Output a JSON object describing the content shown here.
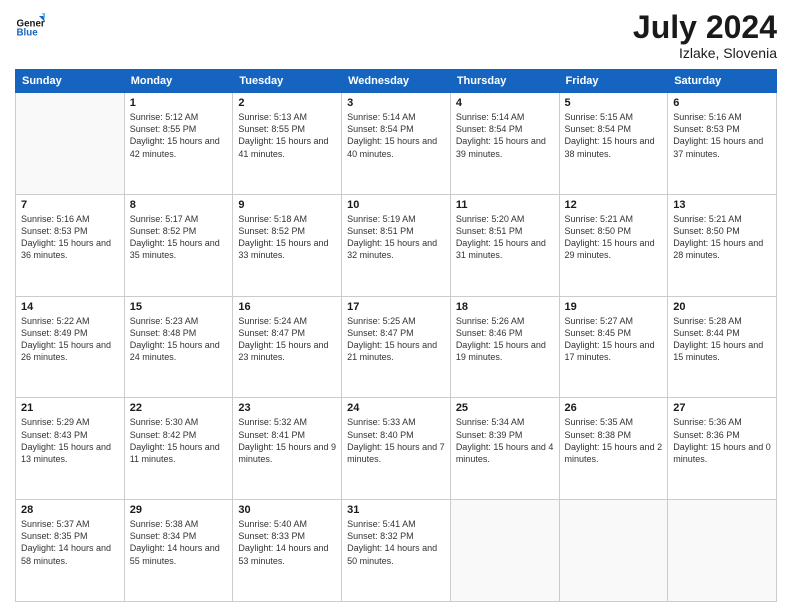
{
  "header": {
    "logo_general": "General",
    "logo_blue": "Blue",
    "month_year": "July 2024",
    "location": "Izlake, Slovenia"
  },
  "days_of_week": [
    "Sunday",
    "Monday",
    "Tuesday",
    "Wednesday",
    "Thursday",
    "Friday",
    "Saturday"
  ],
  "weeks": [
    [
      {
        "day": "",
        "info": ""
      },
      {
        "day": "1",
        "info": "Sunrise: 5:12 AM\nSunset: 8:55 PM\nDaylight: 15 hours\nand 42 minutes."
      },
      {
        "day": "2",
        "info": "Sunrise: 5:13 AM\nSunset: 8:55 PM\nDaylight: 15 hours\nand 41 minutes."
      },
      {
        "day": "3",
        "info": "Sunrise: 5:14 AM\nSunset: 8:54 PM\nDaylight: 15 hours\nand 40 minutes."
      },
      {
        "day": "4",
        "info": "Sunrise: 5:14 AM\nSunset: 8:54 PM\nDaylight: 15 hours\nand 39 minutes."
      },
      {
        "day": "5",
        "info": "Sunrise: 5:15 AM\nSunset: 8:54 PM\nDaylight: 15 hours\nand 38 minutes."
      },
      {
        "day": "6",
        "info": "Sunrise: 5:16 AM\nSunset: 8:53 PM\nDaylight: 15 hours\nand 37 minutes."
      }
    ],
    [
      {
        "day": "7",
        "info": "Sunrise: 5:16 AM\nSunset: 8:53 PM\nDaylight: 15 hours\nand 36 minutes."
      },
      {
        "day": "8",
        "info": "Sunrise: 5:17 AM\nSunset: 8:52 PM\nDaylight: 15 hours\nand 35 minutes."
      },
      {
        "day": "9",
        "info": "Sunrise: 5:18 AM\nSunset: 8:52 PM\nDaylight: 15 hours\nand 33 minutes."
      },
      {
        "day": "10",
        "info": "Sunrise: 5:19 AM\nSunset: 8:51 PM\nDaylight: 15 hours\nand 32 minutes."
      },
      {
        "day": "11",
        "info": "Sunrise: 5:20 AM\nSunset: 8:51 PM\nDaylight: 15 hours\nand 31 minutes."
      },
      {
        "day": "12",
        "info": "Sunrise: 5:21 AM\nSunset: 8:50 PM\nDaylight: 15 hours\nand 29 minutes."
      },
      {
        "day": "13",
        "info": "Sunrise: 5:21 AM\nSunset: 8:50 PM\nDaylight: 15 hours\nand 28 minutes."
      }
    ],
    [
      {
        "day": "14",
        "info": "Sunrise: 5:22 AM\nSunset: 8:49 PM\nDaylight: 15 hours\nand 26 minutes."
      },
      {
        "day": "15",
        "info": "Sunrise: 5:23 AM\nSunset: 8:48 PM\nDaylight: 15 hours\nand 24 minutes."
      },
      {
        "day": "16",
        "info": "Sunrise: 5:24 AM\nSunset: 8:47 PM\nDaylight: 15 hours\nand 23 minutes."
      },
      {
        "day": "17",
        "info": "Sunrise: 5:25 AM\nSunset: 8:47 PM\nDaylight: 15 hours\nand 21 minutes."
      },
      {
        "day": "18",
        "info": "Sunrise: 5:26 AM\nSunset: 8:46 PM\nDaylight: 15 hours\nand 19 minutes."
      },
      {
        "day": "19",
        "info": "Sunrise: 5:27 AM\nSunset: 8:45 PM\nDaylight: 15 hours\nand 17 minutes."
      },
      {
        "day": "20",
        "info": "Sunrise: 5:28 AM\nSunset: 8:44 PM\nDaylight: 15 hours\nand 15 minutes."
      }
    ],
    [
      {
        "day": "21",
        "info": "Sunrise: 5:29 AM\nSunset: 8:43 PM\nDaylight: 15 hours\nand 13 minutes."
      },
      {
        "day": "22",
        "info": "Sunrise: 5:30 AM\nSunset: 8:42 PM\nDaylight: 15 hours\nand 11 minutes."
      },
      {
        "day": "23",
        "info": "Sunrise: 5:32 AM\nSunset: 8:41 PM\nDaylight: 15 hours\nand 9 minutes."
      },
      {
        "day": "24",
        "info": "Sunrise: 5:33 AM\nSunset: 8:40 PM\nDaylight: 15 hours\nand 7 minutes."
      },
      {
        "day": "25",
        "info": "Sunrise: 5:34 AM\nSunset: 8:39 PM\nDaylight: 15 hours\nand 4 minutes."
      },
      {
        "day": "26",
        "info": "Sunrise: 5:35 AM\nSunset: 8:38 PM\nDaylight: 15 hours\nand 2 minutes."
      },
      {
        "day": "27",
        "info": "Sunrise: 5:36 AM\nSunset: 8:36 PM\nDaylight: 15 hours\nand 0 minutes."
      }
    ],
    [
      {
        "day": "28",
        "info": "Sunrise: 5:37 AM\nSunset: 8:35 PM\nDaylight: 14 hours\nand 58 minutes."
      },
      {
        "day": "29",
        "info": "Sunrise: 5:38 AM\nSunset: 8:34 PM\nDaylight: 14 hours\nand 55 minutes."
      },
      {
        "day": "30",
        "info": "Sunrise: 5:40 AM\nSunset: 8:33 PM\nDaylight: 14 hours\nand 53 minutes."
      },
      {
        "day": "31",
        "info": "Sunrise: 5:41 AM\nSunset: 8:32 PM\nDaylight: 14 hours\nand 50 minutes."
      },
      {
        "day": "",
        "info": ""
      },
      {
        "day": "",
        "info": ""
      },
      {
        "day": "",
        "info": ""
      }
    ]
  ]
}
